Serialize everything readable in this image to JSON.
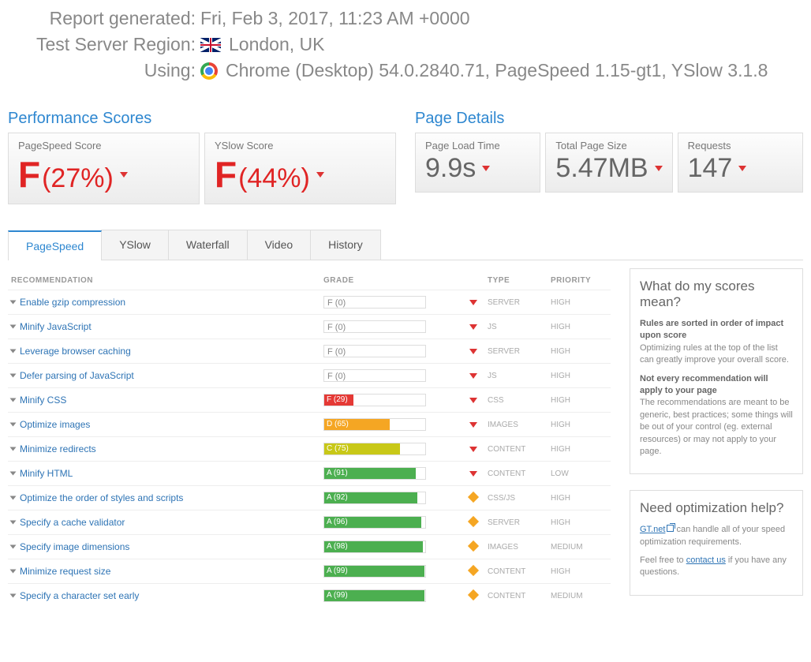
{
  "meta": {
    "generated_label": "Report generated:",
    "generated_value": "Fri, Feb 3, 2017, 11:23 AM +0000",
    "region_label": "Test Server Region:",
    "region_value": "London, UK",
    "using_label": "Using:",
    "using_value": "Chrome (Desktop) 54.0.2840.71, PageSpeed 1.15-gt1, YSlow 3.1.8"
  },
  "panels": {
    "perf_title": "Performance Scores",
    "details_title": "Page Details",
    "pagespeed": {
      "label": "PageSpeed Score",
      "grade": "F",
      "pct": "(27%)"
    },
    "yslow": {
      "label": "YSlow Score",
      "grade": "F",
      "pct": "(44%)"
    },
    "load": {
      "label": "Page Load Time",
      "value": "9.9s"
    },
    "size": {
      "label": "Total Page Size",
      "value": "5.47MB"
    },
    "requests": {
      "label": "Requests",
      "value": "147"
    }
  },
  "tabs": [
    "PageSpeed",
    "YSlow",
    "Waterfall",
    "Video",
    "History"
  ],
  "table": {
    "headers": {
      "rec": "RECOMMENDATION",
      "grade": "GRADE",
      "type": "TYPE",
      "priority": "PRIORITY"
    },
    "rows": [
      {
        "rec": "Enable gzip compression",
        "grade_text": "F (0)",
        "fill_pct": 0,
        "fill_color": "red",
        "icon": "down",
        "type": "SERVER",
        "priority": "HIGH"
      },
      {
        "rec": "Minify JavaScript",
        "grade_text": "F (0)",
        "fill_pct": 0,
        "fill_color": "red",
        "icon": "down",
        "type": "JS",
        "priority": "HIGH"
      },
      {
        "rec": "Leverage browser caching",
        "grade_text": "F (0)",
        "fill_pct": 0,
        "fill_color": "red",
        "icon": "down",
        "type": "SERVER",
        "priority": "HIGH"
      },
      {
        "rec": "Defer parsing of JavaScript",
        "grade_text": "F (0)",
        "fill_pct": 0,
        "fill_color": "red",
        "icon": "down",
        "type": "JS",
        "priority": "HIGH"
      },
      {
        "rec": "Minify CSS",
        "grade_text": "F (29)",
        "fill_pct": 29,
        "fill_color": "red",
        "icon": "down",
        "type": "CSS",
        "priority": "HIGH"
      },
      {
        "rec": "Optimize images",
        "grade_text": "D (65)",
        "fill_pct": 65,
        "fill_color": "orange",
        "icon": "down",
        "type": "IMAGES",
        "priority": "HIGH"
      },
      {
        "rec": "Minimize redirects",
        "grade_text": "C (75)",
        "fill_pct": 75,
        "fill_color": "yellow",
        "icon": "down",
        "type": "CONTENT",
        "priority": "HIGH"
      },
      {
        "rec": "Minify HTML",
        "grade_text": "A (91)",
        "fill_pct": 91,
        "fill_color": "green",
        "icon": "down",
        "type": "CONTENT",
        "priority": "LOW"
      },
      {
        "rec": "Optimize the order of styles and scripts",
        "grade_text": "A (92)",
        "fill_pct": 92,
        "fill_color": "green",
        "icon": "diamond",
        "type": "CSS/JS",
        "priority": "HIGH"
      },
      {
        "rec": "Specify a cache validator",
        "grade_text": "A (96)",
        "fill_pct": 96,
        "fill_color": "green",
        "icon": "diamond",
        "type": "SERVER",
        "priority": "HIGH"
      },
      {
        "rec": "Specify image dimensions",
        "grade_text": "A (98)",
        "fill_pct": 98,
        "fill_color": "green",
        "icon": "diamond",
        "type": "IMAGES",
        "priority": "MEDIUM"
      },
      {
        "rec": "Minimize request size",
        "grade_text": "A (99)",
        "fill_pct": 99,
        "fill_color": "green",
        "icon": "diamond",
        "type": "CONTENT",
        "priority": "HIGH"
      },
      {
        "rec": "Specify a character set early",
        "grade_text": "A (99)",
        "fill_pct": 99,
        "fill_color": "green",
        "icon": "diamond",
        "type": "CONTENT",
        "priority": "MEDIUM"
      }
    ]
  },
  "sidebar": {
    "scores": {
      "title": "What do my scores mean?",
      "p1_strong": "Rules are sorted in order of impact upon score",
      "p1_rest": "Optimizing rules at the top of the list can greatly improve your overall score.",
      "p2_strong": "Not every recommendation will apply to your page",
      "p2_rest": "The recommendations are meant to be generic, best practices; some things will be out of your control (eg. external resources) or may not apply to your page."
    },
    "help": {
      "title": "Need optimization help?",
      "link1": "GT.net",
      "p1_rest": " can handle all of your speed optimization requirements.",
      "p2_a": "Feel free to ",
      "link2": "contact us",
      "p2_b": " if you have any questions."
    }
  }
}
